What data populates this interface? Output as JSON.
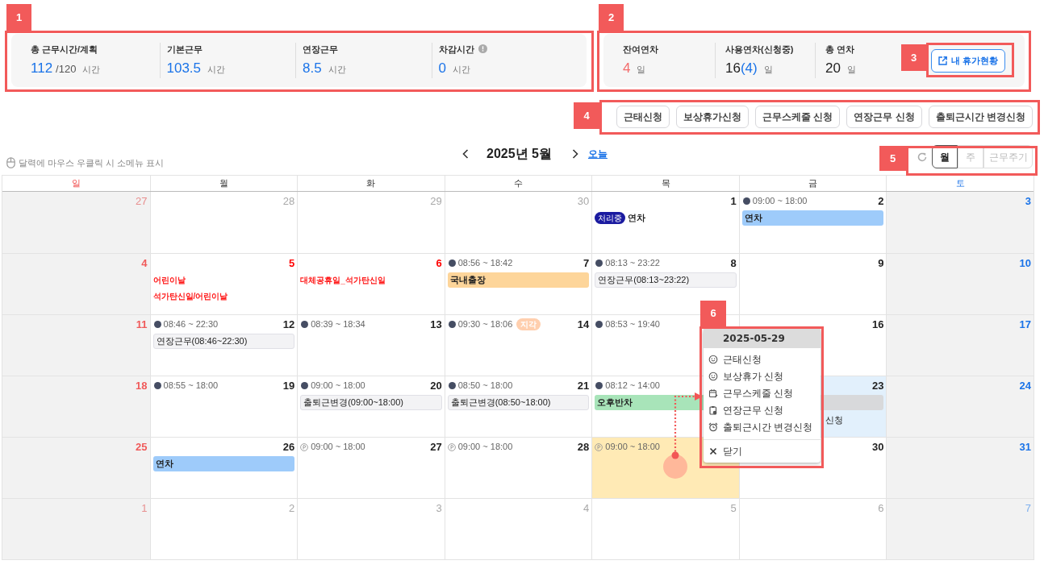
{
  "summary": {
    "items": [
      {
        "label": "총 근무시간/계획",
        "value": "112",
        "total": "/120",
        "unit": "시간",
        "has_info": false
      },
      {
        "label": "기본근무",
        "value": "103.5",
        "unit": "시간",
        "has_info": false
      },
      {
        "label": "연장근무",
        "value": "8.5",
        "unit": "시간",
        "has_info": false
      },
      {
        "label": "차감시간",
        "value": "0",
        "unit": "시간",
        "has_info": true
      }
    ]
  },
  "leave": {
    "items": [
      {
        "label": "잔여연차",
        "value": "4",
        "unit": "일",
        "color": "#f36b6b"
      },
      {
        "label": "사용연차(신청중)",
        "value": "16",
        "pending": "(4)",
        "unit": "일",
        "color": "#222222"
      },
      {
        "label": "총 연차",
        "value": "20",
        "unit": "일",
        "color": "#222222"
      }
    ],
    "button": "내 휴가현황"
  },
  "request_buttons": [
    "근태신청",
    "보상휴가신청",
    "근무스케줄 신청",
    "연장근무 신청",
    "출퇴근시간 변경신청"
  ],
  "hint": "달력에 마우스 우클릭 시 소메뉴 표시",
  "month": "2025년 5월",
  "today_link": "오늘",
  "view_tabs": [
    {
      "label": "월",
      "selected": true
    },
    {
      "label": "주",
      "selected": false
    },
    {
      "label": "근무주기",
      "selected": false
    }
  ],
  "calendar": {
    "weekdays": [
      "일",
      "월",
      "화",
      "수",
      "목",
      "금",
      "토"
    ],
    "weeks": [
      {
        "days": [
          {
            "day": "27",
            "other_month": true,
            "today": false,
            "selected": false
          },
          {
            "day": "28",
            "other_month": true,
            "today": false,
            "selected": false
          },
          {
            "day": "29",
            "other_month": true,
            "today": false,
            "selected": false
          },
          {
            "day": "30",
            "other_month": true,
            "today": false,
            "selected": false
          },
          {
            "day": "1",
            "other_month": false,
            "today": false,
            "selected": false,
            "events": [
              {
                "kind": "status",
                "badge": "처리중",
                "label": "연차"
              }
            ]
          },
          {
            "day": "2",
            "other_month": false,
            "today": false,
            "selected": false,
            "clock": {
              "kind": "actual",
              "text": "09:00 ~ 18:00"
            },
            "events": [
              {
                "kind": "bar",
                "label": "연차",
                "color": "#9ecbfa"
              }
            ]
          },
          {
            "day": "3",
            "other_month": false,
            "today": false,
            "selected": false
          }
        ]
      },
      {
        "days": [
          {
            "day": "4",
            "other_month": false,
            "today": false,
            "selected": false
          },
          {
            "day": "5",
            "other_month": false,
            "today": false,
            "selected": false,
            "events": [
              {
                "kind": "holiday",
                "label": "어린이날"
              },
              {
                "kind": "holiday",
                "label": "석가탄신일/어린이날"
              }
            ]
          },
          {
            "day": "6",
            "other_month": false,
            "today": false,
            "selected": false,
            "events": [
              {
                "kind": "holiday",
                "label": "대체공휴일_석가탄신일"
              }
            ]
          },
          {
            "day": "7",
            "other_month": false,
            "today": false,
            "selected": false,
            "clock": {
              "kind": "actual",
              "text": "08:56 ~ 18:42"
            },
            "events": [
              {
                "kind": "bar",
                "label": "국내출장",
                "color": "#fdd59a"
              }
            ]
          },
          {
            "day": "8",
            "other_month": false,
            "today": false,
            "selected": false,
            "clock": {
              "kind": "actual",
              "text": "08:13 ~ 23:22"
            },
            "events": [
              {
                "kind": "log",
                "label": "연장근무(08:13~23:22)"
              }
            ]
          },
          {
            "day": "9",
            "other_month": false,
            "today": false,
            "selected": false
          },
          {
            "day": "10",
            "other_month": false,
            "today": false,
            "selected": false
          }
        ]
      },
      {
        "days": [
          {
            "day": "11",
            "other_month": false,
            "today": false,
            "selected": false
          },
          {
            "day": "12",
            "other_month": false,
            "today": false,
            "selected": false,
            "clock": {
              "kind": "actual",
              "text": "08:46 ~ 22:30"
            },
            "events": [
              {
                "kind": "log",
                "label": "연장근무(08:46~22:30)"
              }
            ]
          },
          {
            "day": "13",
            "other_month": false,
            "today": false,
            "selected": false,
            "clock": {
              "kind": "actual",
              "text": "08:39 ~ 18:34"
            }
          },
          {
            "day": "14",
            "other_month": false,
            "today": false,
            "selected": false,
            "clock": {
              "kind": "actual",
              "text": "09:30 ~ 18:06",
              "badge": "지각"
            }
          },
          {
            "other_month": false,
            "today": false,
            "selected": false,
            "clock": {
              "kind": "actual",
              "text": "08:53 ~ 19:40"
            }
          },
          {
            "day": "16",
            "other_month": false,
            "today": false,
            "selected": false
          },
          {
            "day": "17",
            "other_month": false,
            "today": false,
            "selected": false
          }
        ]
      },
      {
        "days": [
          {
            "day": "18",
            "other_month": false,
            "today": false,
            "selected": false
          },
          {
            "day": "19",
            "other_month": false,
            "today": false,
            "selected": false,
            "clock": {
              "kind": "actual",
              "text": "08:55 ~ 18:00"
            }
          },
          {
            "day": "20",
            "other_month": false,
            "today": false,
            "selected": false,
            "clock": {
              "kind": "actual",
              "text": "09:00 ~ 18:00"
            },
            "events": [
              {
                "kind": "log",
                "label": "출퇴근변경(09:00~18:00)"
              }
            ]
          },
          {
            "day": "21",
            "other_month": false,
            "today": false,
            "selected": false,
            "clock": {
              "kind": "actual",
              "text": "08:50 ~ 18:00"
            },
            "events": [
              {
                "kind": "log",
                "label": "출퇴근변경(08:50~18:00)"
              }
            ]
          },
          {
            "other_month": false,
            "today": false,
            "selected": false,
            "clock": {
              "kind": "actual",
              "text": "08:12 ~ 14:00"
            },
            "events": [
              {
                "kind": "bar",
                "label": "오후반차",
                "color": "#a8e4b9"
              }
            ]
          },
          {
            "day": "23",
            "other_month": false,
            "today": true,
            "selected": false,
            "events": [
              {
                "kind": "bar",
                "color": "#d8d9db"
              },
              {
                "kind": "note",
                "label": "신청"
              }
            ]
          },
          {
            "day": "24",
            "other_month": false,
            "today": false,
            "selected": false
          }
        ]
      },
      {
        "days": [
          {
            "day": "25",
            "other_month": false,
            "today": false,
            "selected": false
          },
          {
            "day": "26",
            "other_month": false,
            "today": false,
            "selected": false,
            "events": [
              {
                "kind": "bar",
                "label": "연차",
                "color": "#9ecbfa"
              }
            ]
          },
          {
            "day": "27",
            "other_month": false,
            "today": false,
            "selected": false,
            "clock": {
              "kind": "planned",
              "text": "09:00 ~ 18:00"
            }
          },
          {
            "day": "28",
            "other_month": false,
            "today": false,
            "selected": false,
            "clock": {
              "kind": "planned",
              "text": "09:00 ~ 18:00"
            }
          },
          {
            "other_month": false,
            "today": false,
            "selected": true,
            "clock": {
              "kind": "planned",
              "text": "09:00 ~ 18:00"
            }
          },
          {
            "day": "30",
            "other_month": false,
            "today": false,
            "selected": false
          },
          {
            "day": "31",
            "other_month": false,
            "today": false,
            "selected": false
          }
        ]
      },
      {
        "days": [
          {
            "day": "1",
            "other_month": true,
            "today": false,
            "selected": false
          },
          {
            "day": "2",
            "other_month": true,
            "today": false,
            "selected": false
          },
          {
            "day": "3",
            "other_month": true,
            "today": false,
            "selected": false
          },
          {
            "day": "4",
            "other_month": true,
            "today": false,
            "selected": false
          },
          {
            "day": "5",
            "other_month": true,
            "today": false,
            "selected": false
          },
          {
            "day": "6",
            "other_month": true,
            "today": false,
            "selected": false
          },
          {
            "day": "7",
            "other_month": true,
            "today": false,
            "selected": false
          }
        ]
      }
    ]
  },
  "context_menu": {
    "date": "2025-05-29",
    "items": [
      {
        "label": "근태신청",
        "kind": "action"
      },
      {
        "label": "보상휴가 신청",
        "kind": "action"
      },
      {
        "label": "근무스케줄 신청",
        "kind": "action"
      },
      {
        "label": "연장근무 신청",
        "kind": "action"
      },
      {
        "label": "출퇴근시간 변경신청",
        "kind": "action"
      },
      {
        "label": "닫기",
        "kind": "close"
      }
    ]
  },
  "callouts": [
    {
      "label": "1"
    },
    {
      "label": "2"
    },
    {
      "label": "3"
    },
    {
      "label": "4"
    },
    {
      "label": "5"
    },
    {
      "label": "6"
    }
  ]
}
